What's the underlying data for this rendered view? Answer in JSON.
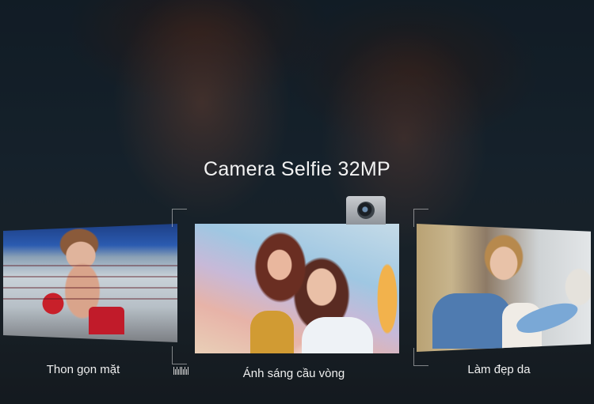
{
  "headline": "Camera Selfie 32MP",
  "features": [
    {
      "label": "Thon gọn mặt"
    },
    {
      "label": "Ánh sáng cầu vòng"
    },
    {
      "label": "Làm đẹp da"
    }
  ],
  "icons": {
    "front_camera": "camera-lens-icon",
    "scale_marker": "barcode-icon"
  },
  "colors": {
    "background": "#1b2530",
    "text": "#f0f0f0"
  }
}
